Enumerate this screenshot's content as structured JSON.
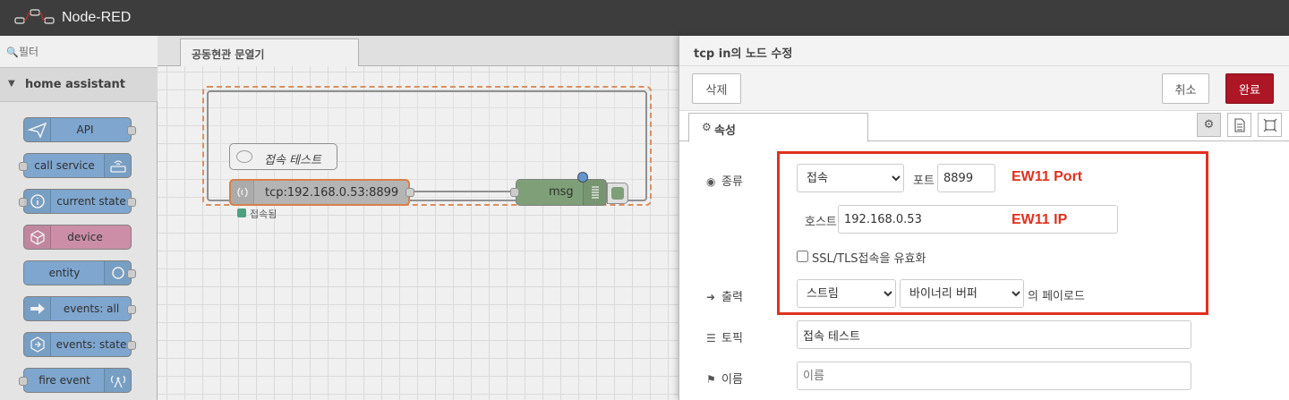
{
  "app": {
    "title": "Node-RED"
  },
  "palette": {
    "search_placeholder": "필터",
    "category": "home assistant",
    "nodes": [
      {
        "label": "API",
        "color": "#86b1dc",
        "icon": "paper-plane-icon"
      },
      {
        "label": "call service",
        "color": "#86b1dc",
        "icon": "router-icon"
      },
      {
        "label": "current state",
        "color": "#86b1dc",
        "icon": "info-circle-icon"
      },
      {
        "label": "device",
        "color": "#d897b1",
        "icon": "cube-icon"
      },
      {
        "label": "entity",
        "color": "#86b1dc",
        "icon": "circle-icon"
      },
      {
        "label": "events: all",
        "color": "#86b1dc",
        "icon": "arrow-right-icon"
      },
      {
        "label": "events: state",
        "color": "#86b1dc",
        "icon": "hexagon-arrow-icon"
      },
      {
        "label": "fire event",
        "color": "#86b1dc",
        "icon": "broadcast-icon"
      }
    ]
  },
  "workspace": {
    "tab": "공동현관 문열기",
    "comment_node": "접속 테스트",
    "tcp_node": "tcp:192.168.0.53:8899",
    "tcp_status": "접속됨",
    "debug_node": "msg"
  },
  "tray": {
    "title": "tcp in의 노드 수정",
    "delete": "삭제",
    "cancel": "취소",
    "done": "완료",
    "tab_properties": "속성",
    "type_label": "종류",
    "type_value": "접속",
    "port_label": "포트",
    "port_value": "8899",
    "host_label": "호스트",
    "host_value": "192.168.0.53",
    "ssl_label": "SSL/TLS접속을 유효화",
    "output_label": "출력",
    "output_value": "스트림",
    "payload_value": "바이너리 버퍼",
    "payload_suffix": "의 페이로드",
    "topic_label": "토픽",
    "topic_value": "접속 테스트",
    "name_label": "이름",
    "name_placeholder": "이름",
    "annotation_port": "EW11 Port",
    "annotation_ip": "EW11 IP",
    "accent_color": "#ad1625",
    "annotation_color": "#e0301e"
  }
}
